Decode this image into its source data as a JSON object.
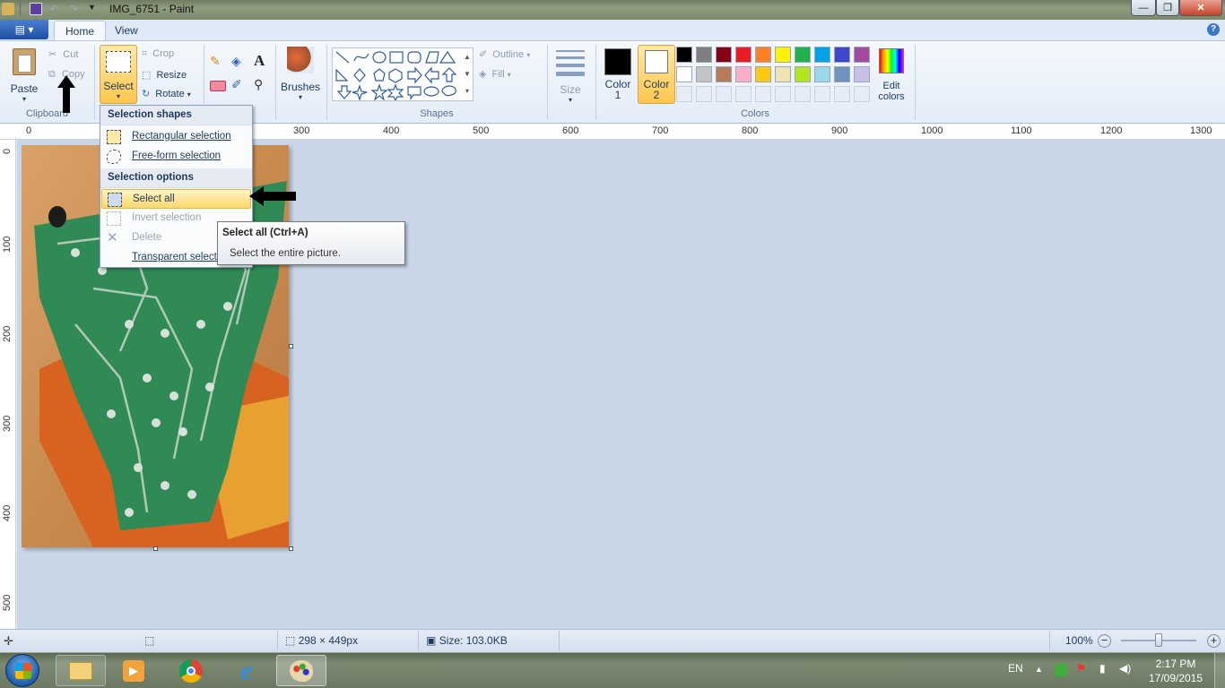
{
  "window": {
    "title": "IMG_6751 - Paint",
    "min": "—",
    "max": "❐",
    "close": "✕"
  },
  "tabs": {
    "home": "Home",
    "view": "View",
    "help": "?"
  },
  "clipboard": {
    "paste": "Paste",
    "cut": "Cut",
    "copy": "Copy",
    "group": "Clipboard"
  },
  "image": {
    "select": "Select",
    "crop": "Crop",
    "resize": "Resize",
    "rotate": "Rotate"
  },
  "tools": {
    "brushes": "Brushes"
  },
  "shapes": {
    "group": "Shapes",
    "outline": "Outline",
    "fill": "Fill",
    "size": "Size"
  },
  "colors": {
    "group": "Colors",
    "color1_line1": "Color",
    "color1_line2": "1",
    "color2_line1": "Color",
    "color2_line2": "2",
    "edit_line1": "Edit",
    "edit_line2": "colors",
    "color1": "#000000",
    "color2": "#ffffff",
    "row1": [
      "#000000",
      "#7f7f7f",
      "#880015",
      "#ed1c24",
      "#ff7f27",
      "#fff200",
      "#22b14c",
      "#00a2e8",
      "#3f48cc",
      "#a349a4"
    ],
    "row2": [
      "#ffffff",
      "#c3c3c3",
      "#b97a57",
      "#ffaec9",
      "#ffc90e",
      "#efe4b0",
      "#b5e61d",
      "#99d9ea",
      "#7092be",
      "#c8bfe7"
    ]
  },
  "ruler": {
    "h": [
      "0",
      "300",
      "400",
      "500",
      "600",
      "700",
      "800",
      "900",
      "1000",
      "1100",
      "1200",
      "1300"
    ],
    "v": [
      "0",
      "100",
      "200",
      "300",
      "400",
      "500"
    ]
  },
  "menu": {
    "shapes_header": "Selection shapes",
    "rect": "Rectangular selection",
    "freeform": "Free-form selection",
    "options_header": "Selection options",
    "select_all": "Select all",
    "invert": "Invert selection",
    "delete": "Delete",
    "transparent": "Transparent selection"
  },
  "tooltip": {
    "title": "Select all (Ctrl+A)",
    "desc": "Select the entire picture."
  },
  "status": {
    "dimensions": "298 × 449px",
    "size": "Size: 103.0KB",
    "zoom": "100%"
  },
  "tray": {
    "lang": "EN",
    "time": "2:17 PM",
    "date": "17/09/2015"
  }
}
